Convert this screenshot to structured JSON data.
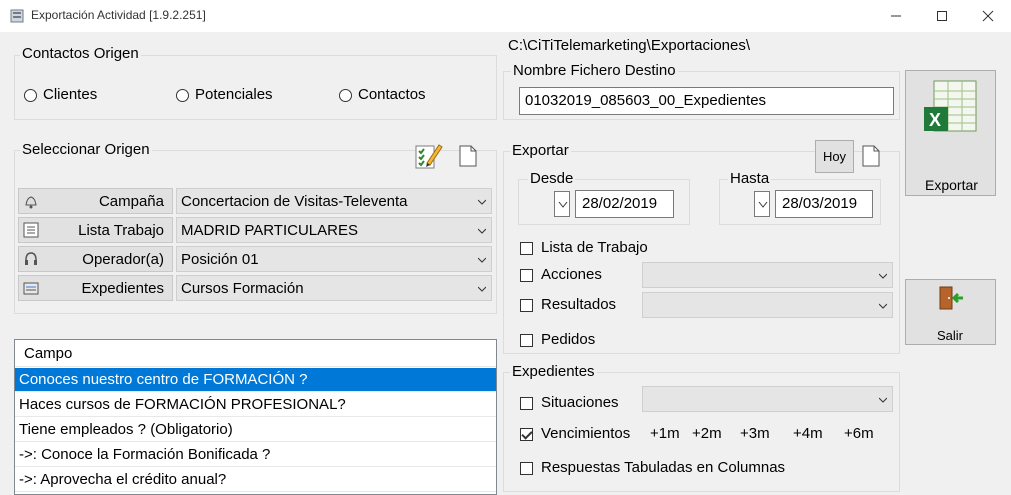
{
  "window": {
    "title": "Exportación Actividad [1.9.2.251]"
  },
  "contactos_origen": {
    "legend": "Contactos Origen",
    "options": [
      "Clientes",
      "Potenciales",
      "Contactos"
    ]
  },
  "seleccionar_origen": {
    "legend": "Seleccionar Origen",
    "rows": [
      {
        "button": "Campaña",
        "value": "Concertacion de Visitas-Televenta",
        "icon": "bell-icon"
      },
      {
        "button": "Lista Trabajo",
        "value": "MADRID PARTICULARES",
        "icon": "list-icon"
      },
      {
        "button": "Operador(a)",
        "value": "Posición 01",
        "icon": "headset-icon"
      },
      {
        "button": "Expedientes",
        "value": "Cursos Formación",
        "icon": "folder-icon"
      }
    ]
  },
  "campo_list": {
    "header": "Campo",
    "items": [
      "Conoces nuestro centro  de FORMACIÓN ?",
      "Haces cursos de FORMACIÓN PROFESIONAL?",
      "Tiene empleados ? (Obligatorio)",
      "->: Conoce la Formación Bonificada ?",
      "->: Aprovecha el crédito anual?"
    ],
    "selected_index": 0
  },
  "path_label": "C:\\CiTiTelemarketing\\Exportaciones\\",
  "nombre_fichero": {
    "legend": "Nombre Fichero Destino",
    "value": "01032019_085603_00_Expedientes"
  },
  "exportar_button": {
    "label": "Exportar"
  },
  "salir_button": {
    "label": "Salir"
  },
  "exportar_group": {
    "legend": "Exportar",
    "hoy_label": "Hoy",
    "desde": {
      "label": "Desde",
      "value": "28/02/2019"
    },
    "hasta": {
      "label": "Hasta",
      "value": "28/03/2019"
    },
    "lista_trabajo": "Lista de Trabajo",
    "acciones": "Acciones",
    "resultados": "Resultados",
    "pedidos": "Pedidos"
  },
  "expedientes_group": {
    "legend": "Expedientes",
    "situaciones": "Situaciones",
    "vencimientos": "Vencimientos",
    "vencimientos_checked": true,
    "offsets": [
      "+1m",
      "+2m",
      "+3m",
      "+4m",
      "+6m"
    ],
    "respuestas": "Respuestas Tabuladas en Columnas"
  },
  "colors": {
    "selection": "#0078d7",
    "background": "#f0f0f0"
  }
}
